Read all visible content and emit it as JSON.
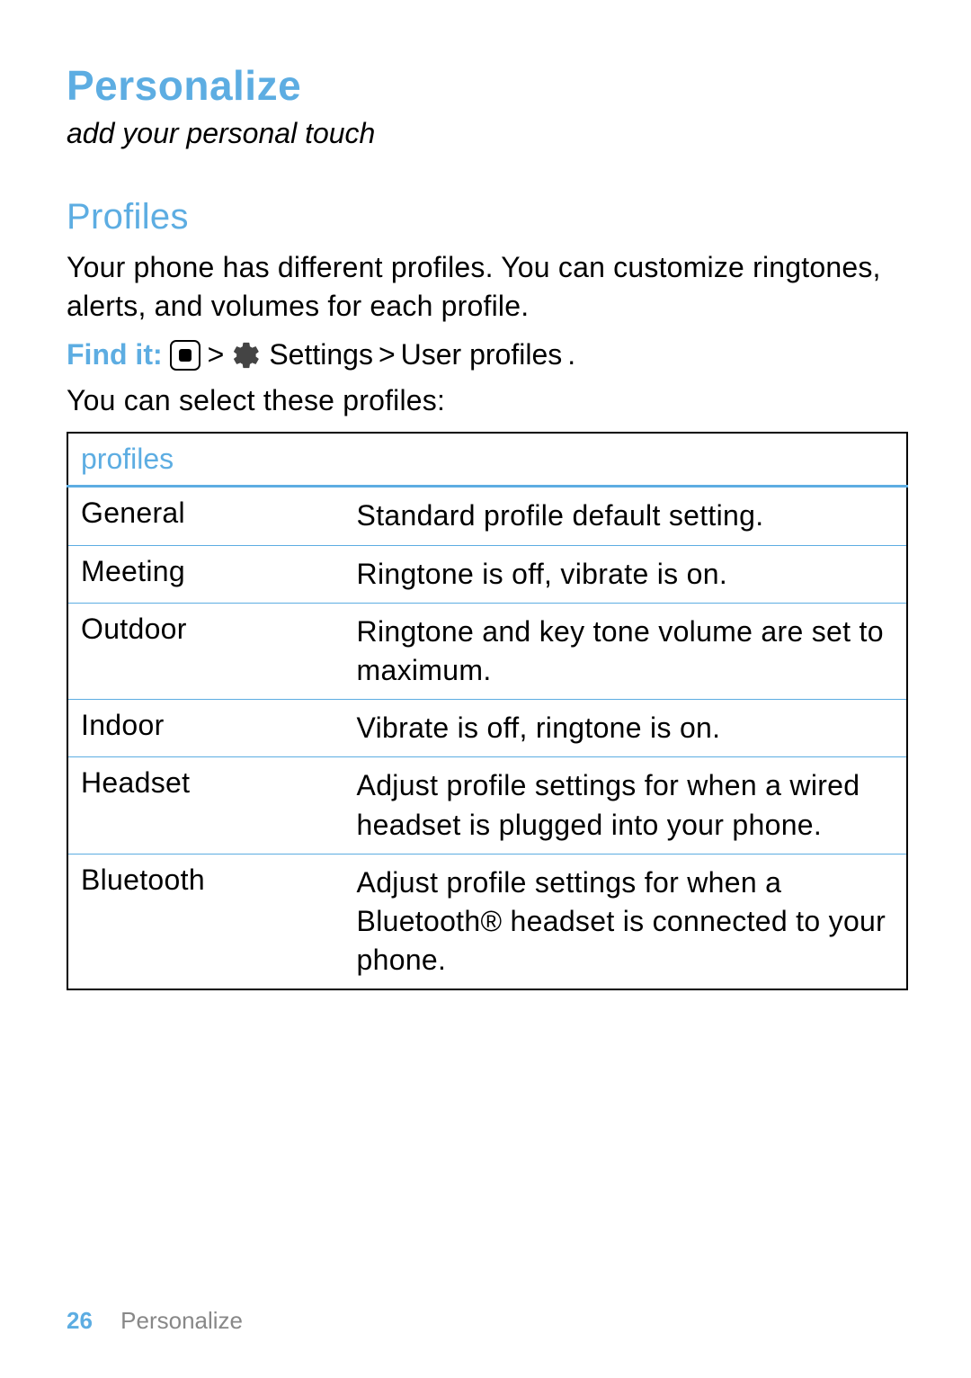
{
  "page_title": "Personalize",
  "subtitle": "add your personal touch",
  "section_heading": "Profiles",
  "intro_text": "Your phone has different profiles. You can customize ringtones, alerts, and volumes for each profile.",
  "find_it": {
    "label": "Find it:",
    "sep1": ">",
    "settings": "Settings",
    "sep2": ">",
    "user_profiles": "User profiles",
    "period": "."
  },
  "select_text": "You can select these profiles:",
  "table": {
    "header": "profiles",
    "rows": [
      {
        "name": "General",
        "desc": "Standard profile default setting."
      },
      {
        "name": "Meeting",
        "desc": "Ringtone is off, vibrate is on."
      },
      {
        "name": "Outdoor",
        "desc": "Ringtone and key tone volume are set to maximum."
      },
      {
        "name": "Indoor",
        "desc": "Vibrate is off, ringtone is on."
      },
      {
        "name": "Headset",
        "desc": "Adjust profile settings for when a wired headset is plugged into your phone."
      },
      {
        "name": "Bluetooth",
        "desc": "Adjust profile settings for when a Bluetooth® headset is connected to your phone."
      }
    ]
  },
  "footer": {
    "page_number": "26",
    "section_name": "Personalize"
  }
}
